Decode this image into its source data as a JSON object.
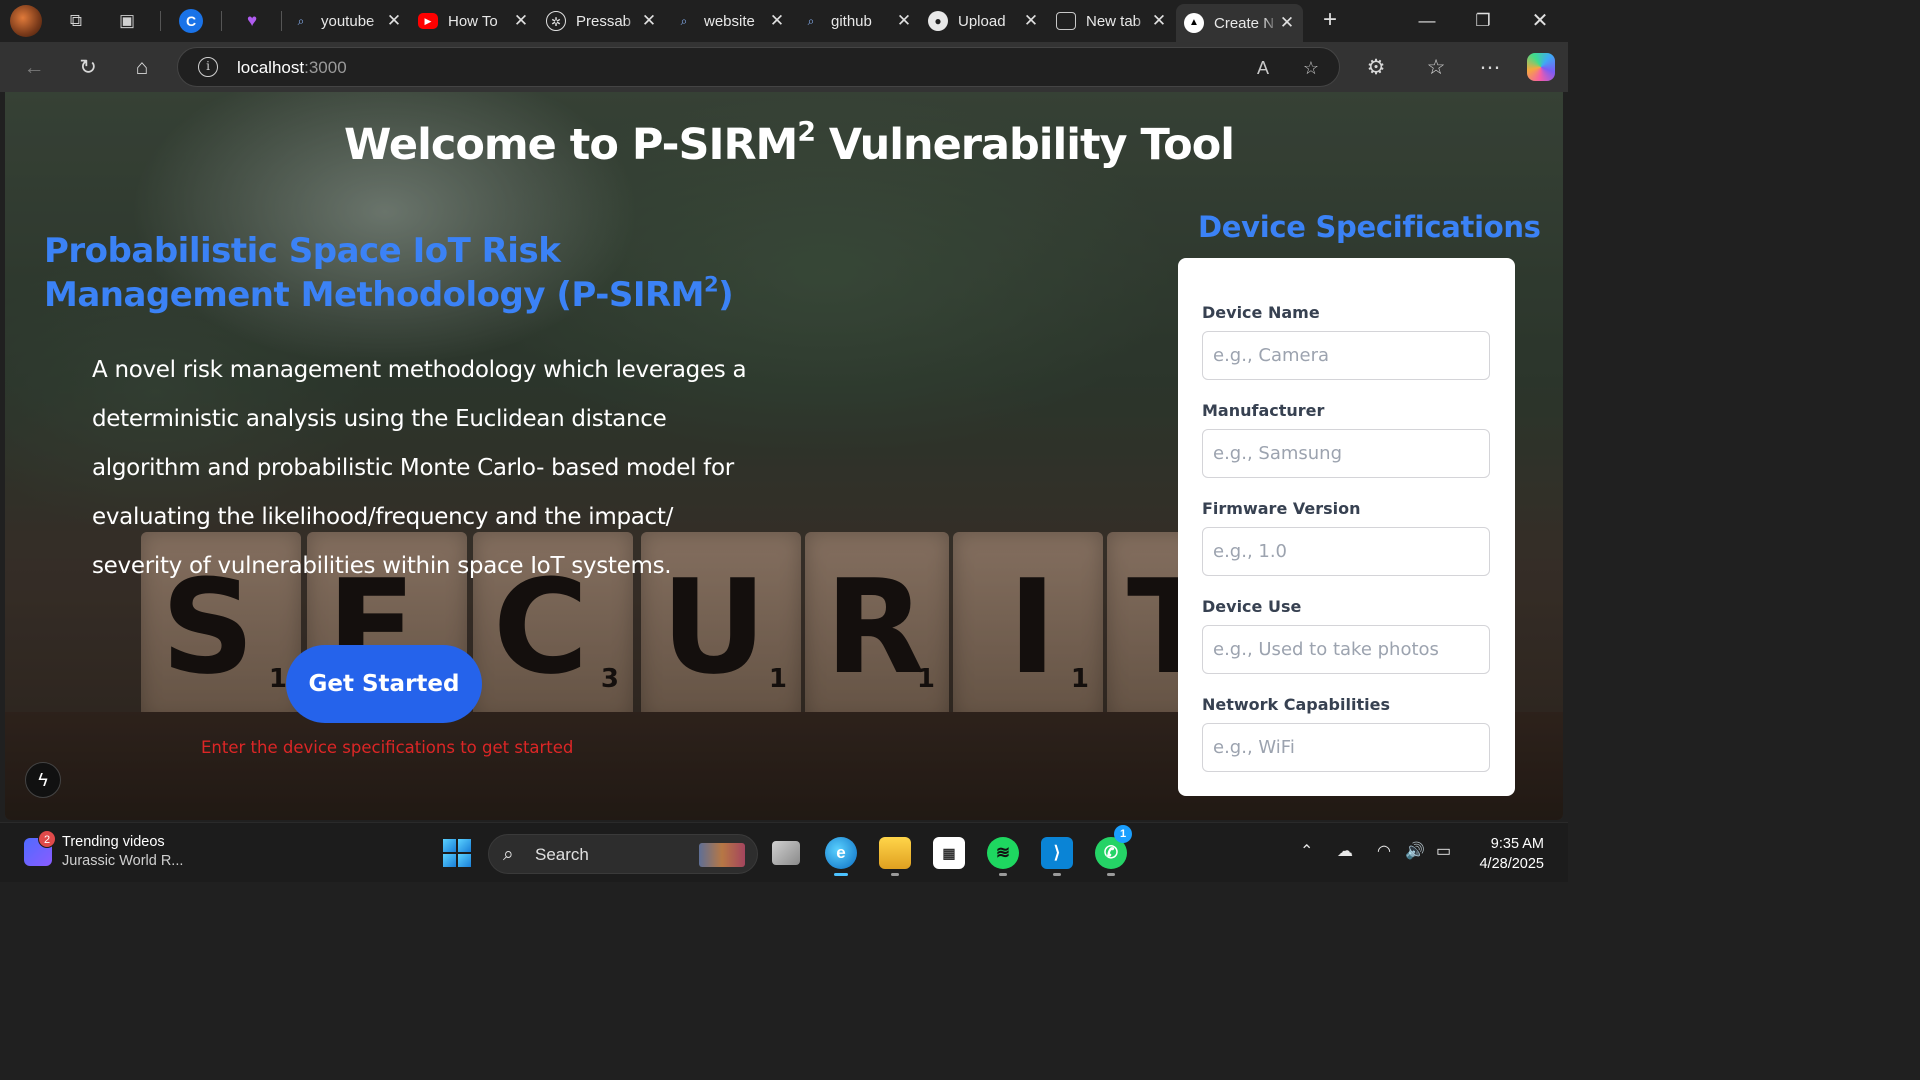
{
  "browser": {
    "tabs": [
      {
        "title": "youtube",
        "icon": "search-icon"
      },
      {
        "title": "How To",
        "icon": "youtube-icon"
      },
      {
        "title": "Pressab",
        "icon": "openai-icon"
      },
      {
        "title": "website",
        "icon": "search-icon"
      },
      {
        "title": "github",
        "icon": "search-icon"
      },
      {
        "title": "Upload",
        "icon": "github-icon"
      },
      {
        "title": "New tab",
        "icon": "newtab-icon"
      },
      {
        "title": "Create N",
        "icon": "vercel-icon"
      }
    ],
    "address": {
      "host": "localhost",
      "port": ":3000"
    }
  },
  "page": {
    "title_prefix": "Welcome to P-SIRM",
    "title_sup": "2",
    "title_suffix": " Vulnerability Tool",
    "subtitle_prefix": "Probabilistic Space IoT Risk Management Methodology (P-SIRM",
    "subtitle_sup": "2",
    "subtitle_suffix": ")",
    "description": "A novel risk management methodology which leverages a deterministic analysis using the Euclidean distance algorithm and probabilistic Monte Carlo- based model for evaluating the likelihood/frequency and the impact/ severity of vulnerabilities within space IoT systems.",
    "cta_label": "Get Started",
    "hint": "Enter the device specifications to get started",
    "background_letters": [
      {
        "letter": "S",
        "num": "1"
      },
      {
        "letter": "E",
        "num": ""
      },
      {
        "letter": "C",
        "num": "3"
      },
      {
        "letter": "U",
        "num": "1"
      },
      {
        "letter": "R",
        "num": "1"
      },
      {
        "letter": "I",
        "num": "1"
      },
      {
        "letter": "T",
        "num": ""
      }
    ],
    "colors": {
      "accent": "#3b82f6",
      "button": "#2563eb",
      "hint": "#dc2626"
    }
  },
  "specs": {
    "heading": "Device Specifications",
    "fields": [
      {
        "label": "Device Name",
        "placeholder": "e.g., Camera",
        "value": ""
      },
      {
        "label": "Manufacturer",
        "placeholder": "e.g., Samsung",
        "value": ""
      },
      {
        "label": "Firmware Version",
        "placeholder": "e.g., 1.0",
        "value": ""
      },
      {
        "label": "Device Use",
        "placeholder": "e.g., Used to take photos",
        "value": ""
      },
      {
        "label": "Network Capabilities",
        "placeholder": "e.g., WiFi",
        "value": ""
      }
    ]
  },
  "taskbar": {
    "widget_badge": "2",
    "widget_line1": "Trending videos",
    "widget_line2": "Jurassic World R...",
    "search_label": "Search",
    "whatsapp_badge": "1",
    "time": "9:35 AM",
    "date": "4/28/2025"
  }
}
